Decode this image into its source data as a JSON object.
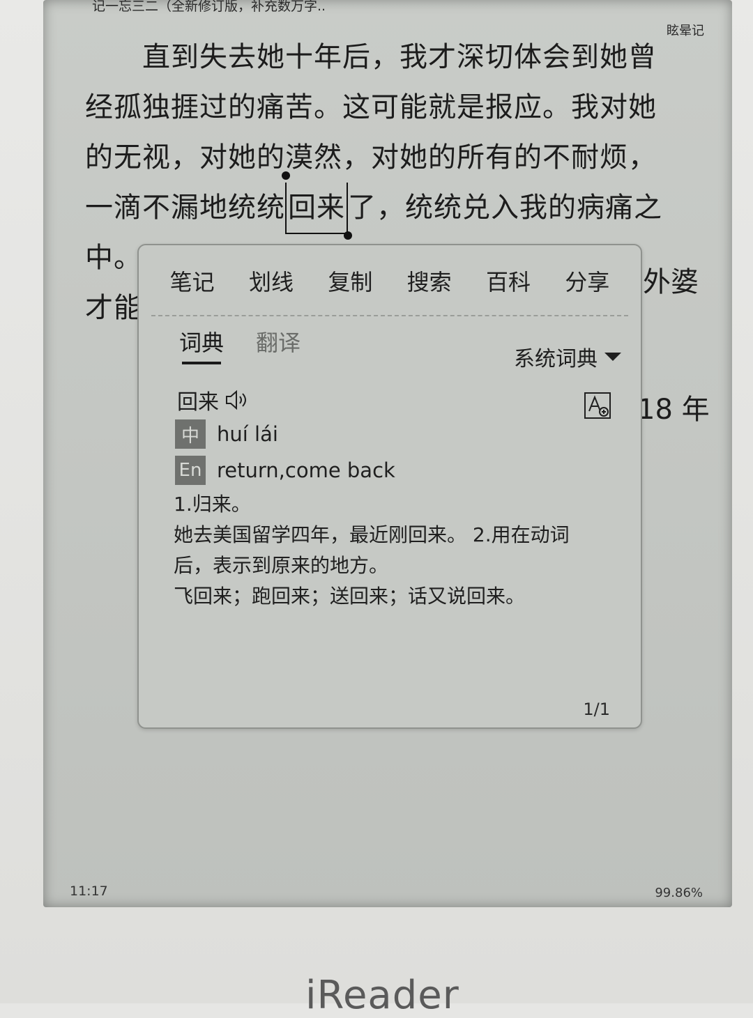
{
  "header": {
    "book_title_fragment": "记一忘三二（全新修订版，补充数万字..",
    "chapter_title": "眩晕记"
  },
  "book": {
    "lines": [
      "　　直到失去她十年后，我才深切体会到她曾",
      "经孤独捱过的痛苦。这可能就是报应。我对她",
      "的无视，对她的漠然，对她的所有的不耐烦，"
    ],
    "line4_before": "一滴不漏地统统",
    "selected_word": "回来",
    "line4_after": "了，统统兑入我的病痛之",
    "line5_start": "中。",
    "line5_end": "外婆",
    "line6_start": "才能",
    "line8_end": "18 年"
  },
  "popup": {
    "actions": [
      "笔记",
      "划线",
      "复制",
      "搜索",
      "百科",
      "分享"
    ],
    "tabs": {
      "dictionary": "词典",
      "translate": "翻译"
    },
    "dictionary_source": "系统词典",
    "headword": "回来",
    "pinyin_badge": "中",
    "pinyin": "huí lái",
    "english_badge": "En",
    "english": "return,come back",
    "definition_lines": [
      "1.归来。",
      "她去美国留学四年，最近刚回来。 2.用在动词",
      "后，表示到原来的地方。",
      "飞回来；跑回来；送回来；话又说回来。"
    ],
    "page_indicator": "1/1"
  },
  "status": {
    "time": "11:17",
    "progress": "99.86%"
  },
  "device": {
    "brand": "iReader"
  }
}
